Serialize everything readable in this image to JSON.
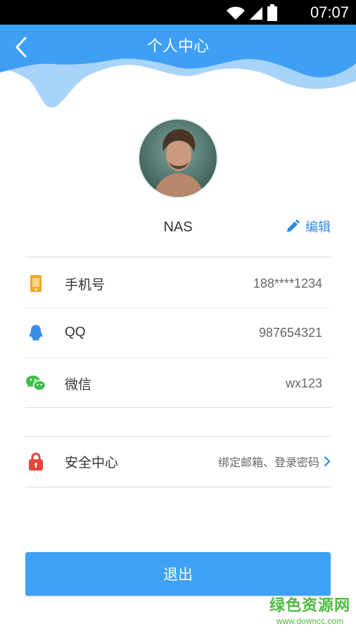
{
  "status_bar": {
    "time": "07:07",
    "icons": [
      "wifi-icon",
      "signal-icon",
      "battery-icon"
    ]
  },
  "header": {
    "title": "个人中心",
    "back_icon": "chevron-left-icon",
    "colors": {
      "wave_light": "#a8d4fb",
      "wave_dark": "#3e9ff5"
    }
  },
  "profile": {
    "username": "NAS",
    "edit_label": "编辑",
    "edit_icon": "pencil-icon"
  },
  "info_rows": [
    {
      "icon": "phone-icon",
      "label": "手机号",
      "value": "188****1234"
    },
    {
      "icon": "qq-icon",
      "label": "QQ",
      "value": "987654321"
    },
    {
      "icon": "wechat-icon",
      "label": "微信",
      "value": "wx123"
    }
  ],
  "security": {
    "icon": "lock-icon",
    "label": "安全中心",
    "value": "绑定邮箱、登录密码"
  },
  "logout_label": "退出",
  "watermark": {
    "title": "绿色资源网",
    "url": "www.downcc.com"
  },
  "colors": {
    "accent": "#3ea1f5",
    "phone_icon": "#f5a623",
    "qq_icon": "#3a8ee6",
    "wechat_icon": "#3bbf4a",
    "lock_icon": "#e8453c"
  }
}
